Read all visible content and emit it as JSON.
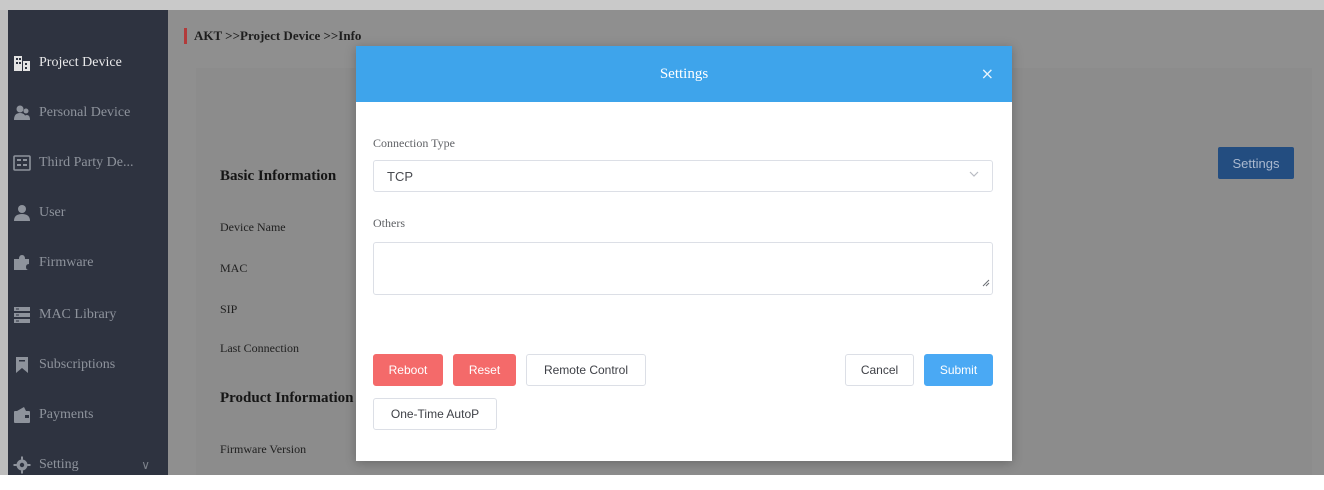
{
  "breadcrumb": "AKT >>Project Device >>Info",
  "sidebar": {
    "items": [
      {
        "label": "Project Device",
        "icon": "building-icon"
      },
      {
        "label": "Personal Device",
        "icon": "users-icon"
      },
      {
        "label": "Third Party De...",
        "icon": "device-panel-icon"
      },
      {
        "label": "User",
        "icon": "user-icon"
      },
      {
        "label": "Firmware",
        "icon": "puzzle-icon"
      },
      {
        "label": "MAC Library",
        "icon": "server-icon"
      },
      {
        "label": "Subscriptions",
        "icon": "bookmark-icon"
      },
      {
        "label": "Payments",
        "icon": "wallet-icon"
      },
      {
        "label": "Setting",
        "icon": "gear-icon",
        "chevron": "∨"
      }
    ]
  },
  "info": {
    "basic_heading": "Basic Information",
    "device_name_label": "Device Name",
    "mac_label": "MAC",
    "sip_label": "SIP",
    "last_connection_label": "Last Connection",
    "product_heading": "Product Information",
    "firmware_version_label": "Firmware Version",
    "settings_button": "Settings"
  },
  "modal": {
    "title": "Settings",
    "close": "×",
    "connection_type_label": "Connection Type",
    "connection_type_value": "TCP",
    "others_label": "Others",
    "others_value": "",
    "buttons": {
      "reboot": "Reboot",
      "reset": "Reset",
      "remote_control": "Remote Control",
      "cancel": "Cancel",
      "submit": "Submit",
      "one_time_autop": "One-Time AutoP"
    }
  },
  "colors": {
    "modal_header": "#3ea4eb",
    "danger": "#f46a6a",
    "primary": "#4aa9f4",
    "sidebar": "#2e3340"
  }
}
